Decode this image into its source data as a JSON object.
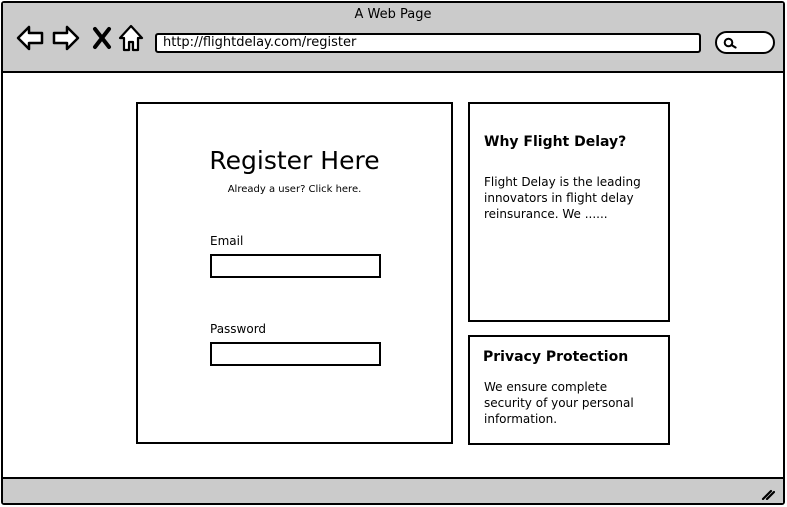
{
  "browser": {
    "window_title": "A Web Page",
    "url": "http://flightdelay.com/register",
    "icons": [
      "back-icon",
      "forward-icon",
      "close-icon",
      "home-icon",
      "search-icon",
      "resize-grip-icon"
    ]
  },
  "register": {
    "title": "Register Here",
    "subtitle": "Already a user? Click here.",
    "email_label": "Email",
    "email_value": "",
    "password_label": "Password",
    "password_value": ""
  },
  "why": {
    "heading": "Why Flight Delay?",
    "body": "Flight Delay is the leading innovators in flight delay reinsurance. We ......"
  },
  "privacy": {
    "heading": "Privacy Protection",
    "body": "We ensure complete security of your personal information."
  }
}
